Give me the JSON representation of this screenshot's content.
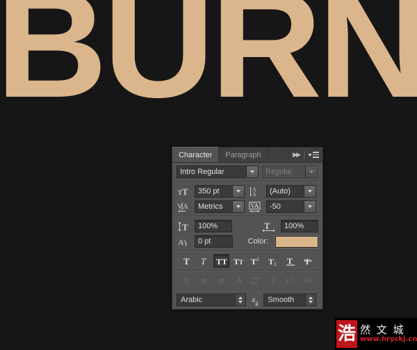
{
  "artwork": {
    "text": "BURN",
    "text_color": "#dbb58c",
    "background_color": "#161616"
  },
  "panel": {
    "tabs": [
      {
        "label": "Character",
        "active": true
      },
      {
        "label": "Paragraph",
        "active": false
      }
    ],
    "header_icons": {
      "collapse": "double-chevron-right-icon",
      "menu": "panel-menu-icon"
    },
    "font": {
      "family_value": "Intro  Regular",
      "style_value": "Regular",
      "style_disabled": true
    },
    "size": {
      "icon": "font-size-icon",
      "value": "350 pt"
    },
    "leading": {
      "icon": "leading-icon",
      "value": "(Auto)"
    },
    "kerning": {
      "icon": "kerning-icon",
      "value": "Metrics"
    },
    "tracking": {
      "icon": "tracking-icon",
      "value": "-50"
    },
    "vertical_scale": {
      "icon": "vertical-scale-icon",
      "value": "100%"
    },
    "horizontal_scale": {
      "icon": "horizontal-scale-icon",
      "value": "100%"
    },
    "baseline_shift": {
      "icon": "baseline-shift-icon",
      "value": "0 pt"
    },
    "color": {
      "label": "Color:",
      "swatch_hex": "#dbb58c"
    },
    "style_buttons": [
      {
        "name": "faux-bold",
        "glyph": "T",
        "active": false,
        "dim": false
      },
      {
        "name": "faux-italic",
        "glyph": "T",
        "active": false,
        "dim": false
      },
      {
        "name": "all-caps",
        "glyph": "TT",
        "active": true,
        "dim": false
      },
      {
        "name": "small-caps",
        "glyph": "TT",
        "active": false,
        "dim": false
      },
      {
        "name": "superscript",
        "glyph": "T1",
        "active": false,
        "dim": false
      },
      {
        "name": "subscript",
        "glyph": "T1",
        "active": false,
        "dim": false
      },
      {
        "name": "underline",
        "glyph": "T",
        "active": false,
        "dim": false
      },
      {
        "name": "strikethrough",
        "glyph": "T",
        "active": false,
        "dim": false
      }
    ],
    "opentype_buttons": [
      {
        "name": "standard-ligatures",
        "glyph": "fi",
        "dim": true
      },
      {
        "name": "contextual-alternates",
        "glyph": "œ",
        "dim": true
      },
      {
        "name": "discretionary-ligatures",
        "glyph": "st",
        "dim": true
      },
      {
        "name": "swash",
        "glyph": "A",
        "dim": true
      },
      {
        "name": "oldstyle",
        "glyph": "aa",
        "dim": true
      },
      {
        "name": "titling-alternates",
        "glyph": "T",
        "dim": true
      },
      {
        "name": "ordinals",
        "glyph": "1st",
        "dim": true
      },
      {
        "name": "fractions",
        "glyph": "½",
        "dim": true
      }
    ],
    "language": {
      "value": "Arabic"
    },
    "anti_alias": {
      "icon": "anti-alias-icon",
      "value": "Smooth"
    }
  },
  "watermark": {
    "seal": "浩",
    "chinese": "然 文 城",
    "url": "www.hryckj.cn",
    "seal_color": "#c0141b",
    "url_color": "#d9202a"
  }
}
